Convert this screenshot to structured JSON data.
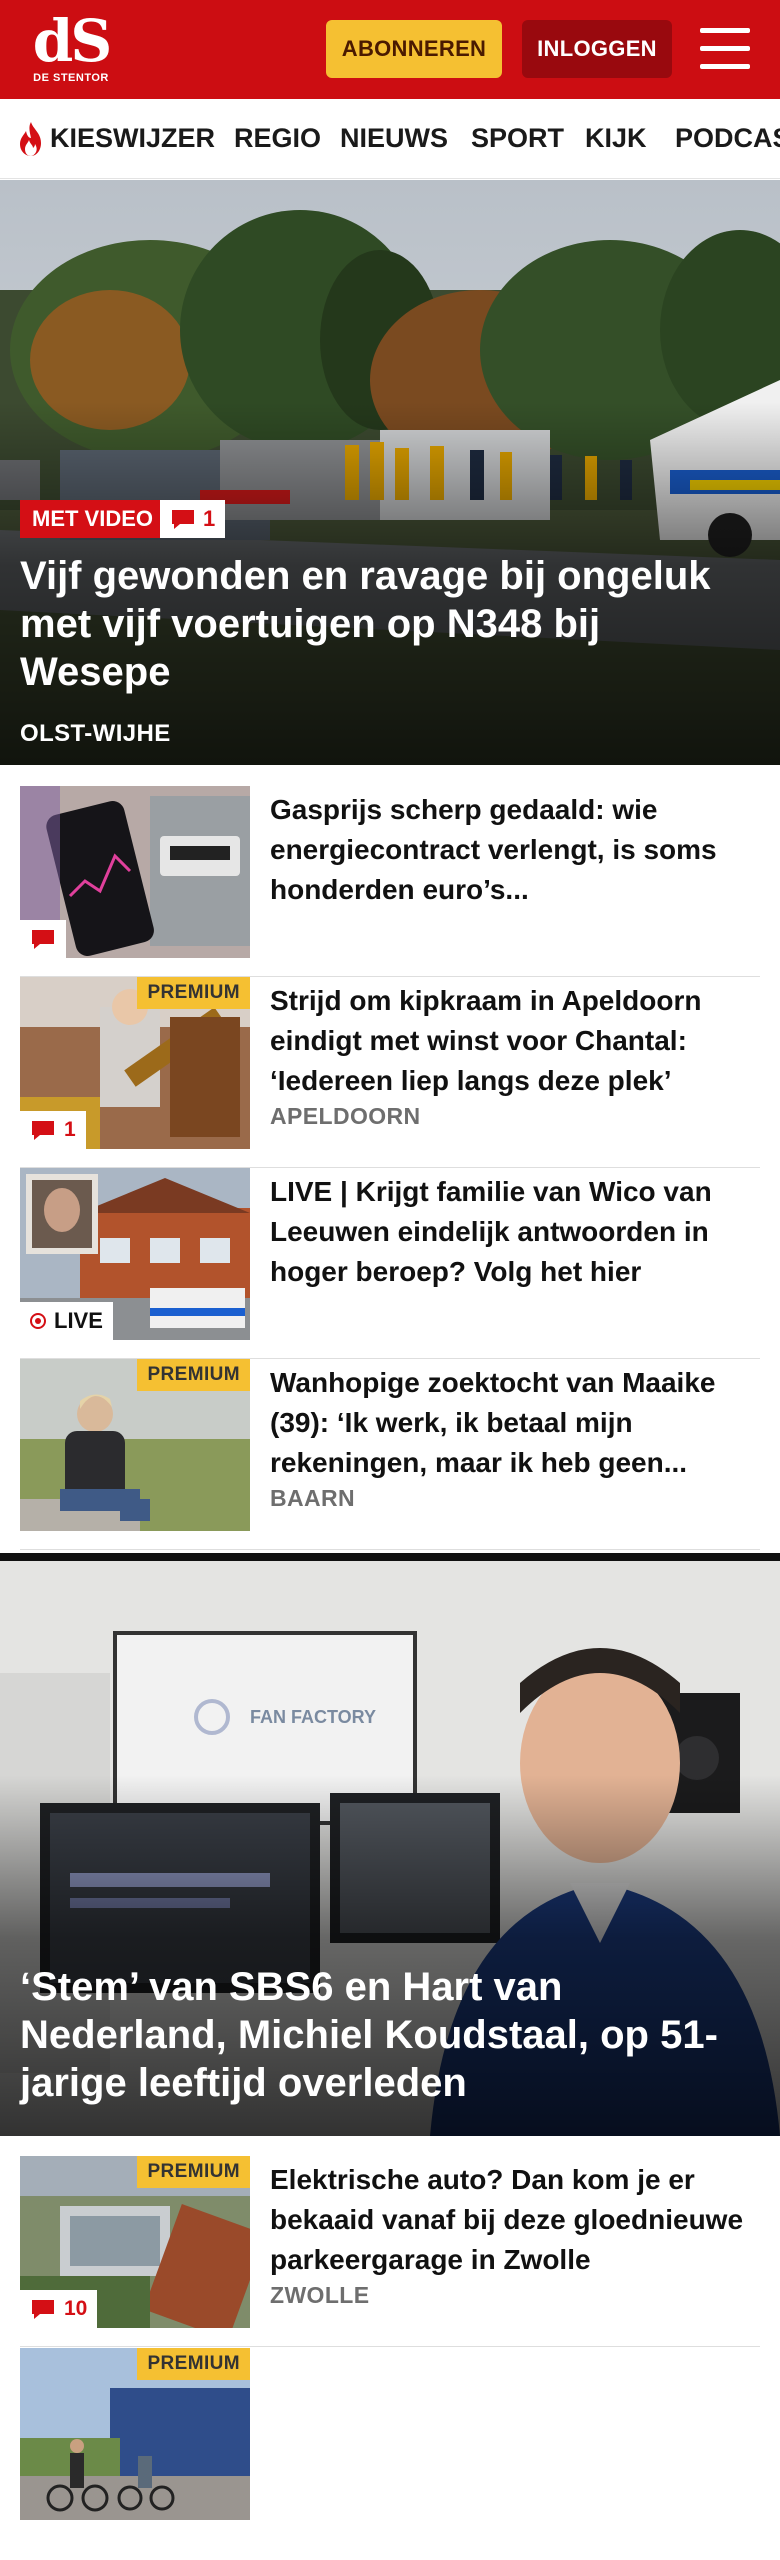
{
  "header": {
    "logo_mark": "dS",
    "logo_name": "DE STENTOR",
    "subscribe_label": "ABONNEREN",
    "login_label": "INLOGGEN"
  },
  "nav": {
    "items": [
      "KIESWIJZER",
      "REGIO",
      "NIEUWS",
      "SPORT",
      "KIJK",
      "PODCAST"
    ]
  },
  "colors": {
    "brand_red": "#cc0d12",
    "login_dark_red": "#99090e",
    "premium_yellow": "#f5c032"
  },
  "hero1": {
    "badge_video": "MET VIDEO",
    "comment_count": "1",
    "title": "Vijf gewonden en ravage bij ongeluk met vijf voertuigen op N348 bij Wesepe",
    "location": "OLST-WIJHE"
  },
  "articles": [
    {
      "title": "Gasprijs scherp gedaald: wie energiecontract verlengt, is soms honderden euro’s...",
      "location": "",
      "premium": "",
      "comments": ""
    },
    {
      "title": "Strijd om kipkraam in Apeldoorn eindigt met winst voor Chantal: ‘Iedereen liep langs deze plek’",
      "location": "APELDOORN",
      "premium": "PREMIUM",
      "comments": "1"
    },
    {
      "title": "LIVE | Krijgt familie van Wico van Leeuwen eindelijk antwoorden in hoger beroep? Volg het hier",
      "location": "",
      "premium": "",
      "live": "LIVE"
    },
    {
      "title": "Wanhopige zoektocht van Maaike (39): ‘Ik werk, ik betaal mijn rekeningen, maar ik heb geen...",
      "location": "BAARN",
      "premium": "PREMIUM"
    }
  ],
  "hero2": {
    "title": "‘Stem’ van SBS6 en Hart van Nederland, Michiel Koudstaal, op 51-jarige leeftijd overleden",
    "screen_text": "FAN FACTORY"
  },
  "articles2": [
    {
      "title": "Elektrische auto? Dan kom je er bekaaid vanaf bij deze gloednieuwe parkeergarage in Zwolle",
      "location": "ZWOLLE",
      "premium": "PREMIUM",
      "comments": "10"
    },
    {
      "title": "",
      "location": "",
      "premium": "PREMIUM"
    }
  ]
}
